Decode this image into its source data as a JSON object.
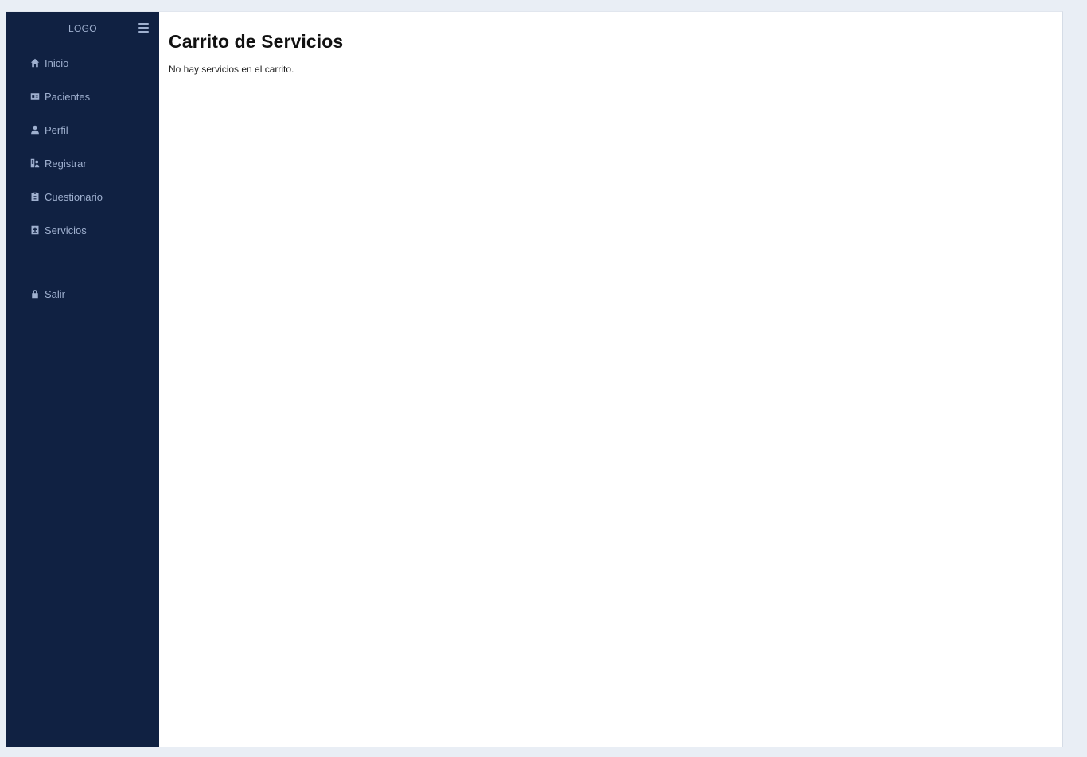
{
  "sidebar": {
    "logo": "LOGO",
    "menu_icon": "hamburger-icon",
    "items": [
      {
        "label": "Inicio",
        "icon": "home-icon"
      },
      {
        "label": "Pacientes",
        "icon": "id-card-icon"
      },
      {
        "label": "Perfil",
        "icon": "user-icon"
      },
      {
        "label": "Registrar",
        "icon": "register-user-icon"
      },
      {
        "label": "Cuestionario",
        "icon": "clipboard-icon"
      },
      {
        "label": "Servicios",
        "icon": "medical-book-icon"
      }
    ],
    "logout": {
      "label": "Salir",
      "icon": "lock-icon"
    }
  },
  "main": {
    "title": "Carrito de Servicios",
    "empty_message": "No hay servicios en el carrito."
  },
  "colors": {
    "sidebar_bg": "#102142",
    "sidebar_text": "#9fb0cf",
    "page_bg": "#e9eef5",
    "content_bg": "#ffffff"
  }
}
